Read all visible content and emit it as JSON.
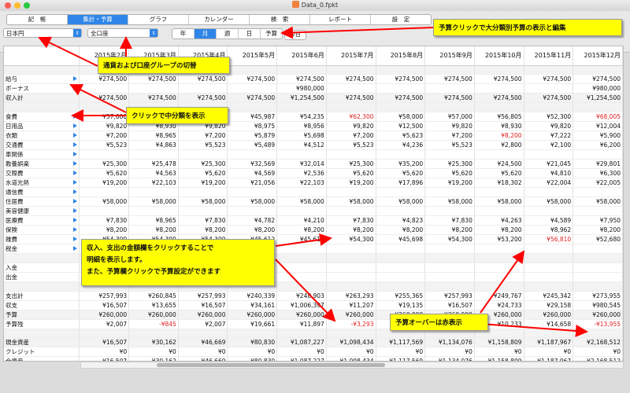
{
  "window": {
    "title": "Data_0.fpkt"
  },
  "tabs": [
    "記　帳",
    "集計・予算",
    "グラフ",
    "カレンダー",
    "検　索",
    "レポート",
    "設　定"
  ],
  "active_tab": 1,
  "currency_select": {
    "value": "日本円"
  },
  "account_select": {
    "value": "全口座"
  },
  "period_buttons": [
    "年",
    "月",
    "週",
    "日",
    "予算"
  ],
  "today_button": "今日",
  "columns": [
    "",
    "2015年2月",
    "2015年3月",
    "2015年4月",
    "2015年5月",
    "2015年6月",
    "2015年7月",
    "2015年8月",
    "2015年9月",
    "2015年10月",
    "2015年11月",
    "2015年12月"
  ],
  "rows": [
    {
      "label": "",
      "cells": [
        "",
        "",
        "",
        "",
        "",
        "",
        "",
        "",
        "",
        "",
        ""
      ]
    },
    {
      "label": "給与",
      "cells": [
        "¥274,500",
        "¥274,500",
        "¥274,500",
        "¥274,500",
        "¥274,500",
        "¥274,500",
        "¥274,500",
        "¥274,500",
        "¥274,500",
        "¥274,500",
        "¥274,500"
      ]
    },
    {
      "label": "ボーナス",
      "cells": [
        "",
        "",
        "",
        "",
        "¥980,000",
        "",
        "",
        "",
        "",
        "",
        "¥980,000"
      ]
    },
    {
      "label": "収入計",
      "cells": [
        "¥274,500",
        "¥274,500",
        "¥274,500",
        "¥274,500",
        "¥1,254,500",
        "¥274,500",
        "¥274,500",
        "¥274,500",
        "¥274,500",
        "¥274,500",
        "¥1,254,500"
      ]
    },
    {
      "label": "",
      "cells": [
        "",
        "",
        "",
        "",
        "",
        "",
        "",
        "",
        "",
        "",
        ""
      ]
    },
    {
      "label": "食費",
      "cells": [
        "¥57,000",
        "¥56,000",
        "¥53,000",
        "¥45,987",
        "¥54,235",
        "¥62,300",
        "¥58,000",
        "¥57,000",
        "¥56,805",
        "¥52,300",
        "¥68,005"
      ]
    },
    {
      "label": "日用品",
      "cells": [
        "¥9,820",
        "¥8,930",
        "¥9,820",
        "¥8,975",
        "¥8,956",
        "¥9,820",
        "¥12,500",
        "¥9,820",
        "¥8,930",
        "¥9,820",
        "¥12,004"
      ]
    },
    {
      "label": "衣類",
      "cells": [
        "¥7,200",
        "¥8,965",
        "¥7,200",
        "¥5,879",
        "¥5,698",
        "¥7,200",
        "¥5,623",
        "¥7,200",
        "¥8,200",
        "¥7,222",
        "¥5,900"
      ]
    },
    {
      "label": "交通費",
      "cells": [
        "¥5,523",
        "¥4,863",
        "¥5,523",
        "¥5,489",
        "¥4,512",
        "¥5,523",
        "¥4,236",
        "¥5,523",
        "¥2,800",
        "¥2,100",
        "¥6,200"
      ]
    },
    {
      "label": "車関係",
      "cells": [
        "",
        "",
        "",
        "",
        "",
        "",
        "",
        "",
        "",
        "",
        ""
      ]
    },
    {
      "label": "教養娯楽",
      "cells": [
        "¥25,300",
        "¥25,478",
        "¥25,300",
        "¥32,569",
        "¥32,014",
        "¥25,300",
        "¥35,200",
        "¥25,300",
        "¥24,500",
        "¥21,045",
        "¥29,801"
      ]
    },
    {
      "label": "交際費",
      "cells": [
        "¥5,620",
        "¥4,563",
        "¥5,620",
        "¥4,569",
        "¥2,536",
        "¥5,620",
        "¥5,620",
        "¥5,620",
        "¥5,620",
        "¥4,810",
        "¥6,300"
      ]
    },
    {
      "label": "水道光熱",
      "cells": [
        "¥19,200",
        "¥22,103",
        "¥19,200",
        "¥21,056",
        "¥22,103",
        "¥19,200",
        "¥17,896",
        "¥19,200",
        "¥18,302",
        "¥22,004",
        "¥22,005"
      ]
    },
    {
      "label": "通信費",
      "cells": [
        "",
        "",
        "",
        "",
        "",
        "",
        "",
        "",
        "",
        "",
        ""
      ]
    },
    {
      "label": "住居費",
      "cells": [
        "¥58,000",
        "¥58,000",
        "¥58,000",
        "¥58,000",
        "¥58,000",
        "¥58,000",
        "¥58,000",
        "¥58,000",
        "¥58,000",
        "¥58,000",
        "¥58,000"
      ]
    },
    {
      "label": "美容健康",
      "cells": [
        "",
        "",
        "",
        "",
        "",
        "",
        "",
        "",
        "",
        "",
        ""
      ]
    },
    {
      "label": "医療費",
      "cells": [
        "¥7,830",
        "¥8,965",
        "¥7,830",
        "¥4,782",
        "¥4,210",
        "¥7,830",
        "¥4,823",
        "¥7,830",
        "¥4,263",
        "¥4,589",
        "¥7,950"
      ]
    },
    {
      "label": "保険",
      "cells": [
        "¥8,200",
        "¥8,200",
        "¥8,200",
        "¥8,200",
        "¥8,200",
        "¥8,200",
        "¥8,200",
        "¥8,200",
        "¥8,200",
        "¥8,962",
        "¥8,200"
      ]
    },
    {
      "label": "雑費",
      "cells": [
        "¥54,300",
        "¥54,300",
        "¥54,300",
        "¥45,612",
        "¥45,612",
        "¥54,300",
        "¥45,698",
        "¥54,300",
        "¥53,200",
        "¥56,810",
        "¥52,680"
      ]
    },
    {
      "label": "税金",
      "cells": [
        "",
        "",
        "",
        "",
        "",
        "",
        "",
        "",
        "",
        "",
        ""
      ]
    },
    {
      "label": "",
      "cells": [
        "",
        "",
        "",
        "",
        "",
        "",
        "",
        "",
        "",
        "",
        ""
      ]
    },
    {
      "label": "入金",
      "cells": [
        "",
        "",
        "",
        "",
        "",
        "",
        "",
        "",
        "",
        "",
        ""
      ]
    },
    {
      "label": "出金",
      "cells": [
        "",
        "",
        "",
        "",
        "",
        "",
        "",
        "",
        "",
        "",
        ""
      ]
    },
    {
      "label": "",
      "cells": [
        "",
        "",
        "",
        "",
        "",
        "",
        "",
        "",
        "",
        "",
        ""
      ]
    },
    {
      "label": "支出計",
      "cells": [
        "¥257,993",
        "¥260,845",
        "¥257,993",
        "¥240,339",
        "¥248,903",
        "¥263,293",
        "¥255,365",
        "¥257,993",
        "¥249,767",
        "¥245,342",
        "¥273,955"
      ]
    },
    {
      "label": "収支",
      "cells": [
        "¥16,507",
        "¥13,655",
        "¥16,507",
        "¥34,161",
        "¥1,006,397",
        "¥11,207",
        "¥19,135",
        "¥16,507",
        "¥24,733",
        "¥29,158",
        "¥980,545"
      ]
    },
    {
      "label": "予算",
      "cells": [
        "¥260,000",
        "¥260,000",
        "¥260,000",
        "¥260,000",
        "¥260,000",
        "¥260,000",
        "¥260,000",
        "¥260,000",
        "¥260,000",
        "¥260,000",
        "¥260,000"
      ]
    },
    {
      "label": "予算残",
      "cells": [
        "¥2,007",
        "-¥845",
        "¥2,007",
        "¥19,661",
        "¥11,897",
        "-¥3,293",
        "¥4,635",
        "¥2,007",
        "¥10,233",
        "¥14,658",
        "-¥13,955"
      ]
    },
    {
      "label": "",
      "cells": [
        "",
        "",
        "",
        "",
        "",
        "",
        "",
        "",
        "",
        "",
        ""
      ]
    },
    {
      "label": "現金資産",
      "cells": [
        "¥16,507",
        "¥30,162",
        "¥46,669",
        "¥80,830",
        "¥1,087,227",
        "¥1,098,434",
        "¥1,117,569",
        "¥1,134,076",
        "¥1,158,809",
        "¥1,187,967",
        "¥2,168,512"
      ]
    },
    {
      "label": "クレジット",
      "cells": [
        "¥0",
        "¥0",
        "¥0",
        "¥0",
        "¥0",
        "¥0",
        "¥0",
        "¥0",
        "¥0",
        "¥0",
        "¥0"
      ]
    },
    {
      "label": "全資産",
      "cells": [
        "¥16,507",
        "¥30,162",
        "¥46,669",
        "¥80,830",
        "¥1,087,227",
        "¥1,098,434",
        "¥1,117,569",
        "¥1,134,076",
        "¥1,158,809",
        "¥1,187,967",
        "¥2,168,512"
      ]
    }
  ],
  "callouts": {
    "budget_click": "予算クリックで大分類別予算の表示と編集",
    "currency_switch": "通貨および口座グループの切替",
    "subcategory": "クリックで中分類を表示",
    "detail_line1": "収入、支出の金額欄をクリックすることで",
    "detail_line2": "明細を表示します。",
    "detail_line3": "また、予算欄クリックで予算設定ができます",
    "over_budget": "予算オーバーは赤表示"
  },
  "colors": {
    "accent": "#2f86e8",
    "negative": "#e02020",
    "callout_bg": "#ffff00",
    "arrow": "#ff0000"
  }
}
